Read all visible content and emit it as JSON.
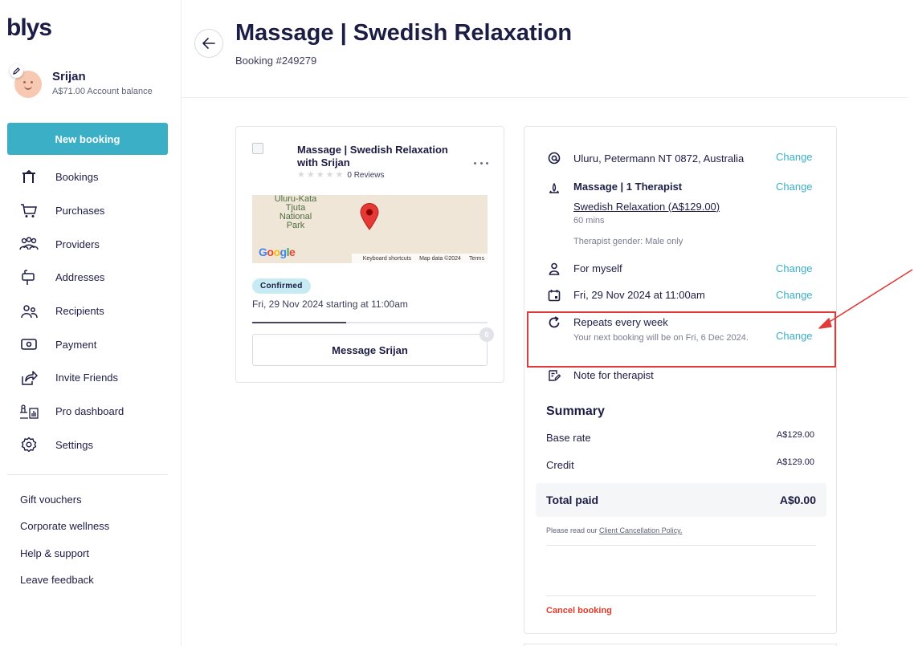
{
  "brand": {
    "logo": "blys"
  },
  "user": {
    "name": "Srijan",
    "balance": "A$71.00 Account balance"
  },
  "sidebar": {
    "new_booking": "New booking",
    "items": [
      {
        "label": "Bookings",
        "icon": "bookings-icon"
      },
      {
        "label": "Purchases",
        "icon": "cart-icon"
      },
      {
        "label": "Providers",
        "icon": "providers-icon"
      },
      {
        "label": "Addresses",
        "icon": "mailbox-icon"
      },
      {
        "label": "Recipients",
        "icon": "recipients-icon"
      },
      {
        "label": "Payment",
        "icon": "payment-icon"
      },
      {
        "label": "Invite Friends",
        "icon": "share-icon"
      },
      {
        "label": "Pro dashboard",
        "icon": "dashboard-icon"
      },
      {
        "label": "Settings",
        "icon": "gear-icon"
      }
    ],
    "footer": [
      "Gift vouchers",
      "Corporate wellness",
      "Help & support",
      "Leave feedback"
    ]
  },
  "header": {
    "title": "Massage | Swedish Relaxation",
    "booking_number": "Booking #249279"
  },
  "booking_card": {
    "title": "Massage | Swedish Relaxation with Srijan",
    "reviews": "0 Reviews",
    "rating": 0,
    "map": {
      "label": "Uluru-Kata Tjuta National Park",
      "google": [
        "G",
        "o",
        "o",
        "g",
        "l",
        "e"
      ],
      "footer": [
        "Keyboard shortcuts",
        "Map data ©2024",
        "Terms"
      ]
    },
    "status": "Confirmed",
    "date": "Fri, 29 Nov 2024 starting at 11:00am",
    "progress": 0.4,
    "message_button": "Message Srijan",
    "message_count": "0"
  },
  "details": {
    "address": "Uluru, Petermann NT 0872, Australia",
    "service": "Massage | 1 Therapist",
    "service_link": "Swedish Relaxation (A$129.00)",
    "duration": "60 mins",
    "therapist_gender": "Therapist gender: Male only",
    "recipient": "For myself",
    "datetime": "Fri, 29 Nov 2024 at 11:00am",
    "repeat_title": "Repeats every week",
    "repeat_sub": "Your next booking will be on Fri, 6 Dec 2024.",
    "note": "Note for therapist",
    "change_label": "Change"
  },
  "summary": {
    "title": "Summary",
    "base_rate_label": "Base rate",
    "base_rate_value": "A$129.00",
    "credit_label": "Credit",
    "credit_value": "A$129.00",
    "total_label": "Total paid",
    "total_value": "A$0.00",
    "policy_prefix": "Please read our ",
    "policy_link": "Client Cancellation Policy.",
    "cancel": "Cancel booking"
  },
  "colors": {
    "accent": "#3aafc6",
    "text": "#1c1d45",
    "danger": "#e03a2a",
    "annotation": "#e03a3a"
  }
}
